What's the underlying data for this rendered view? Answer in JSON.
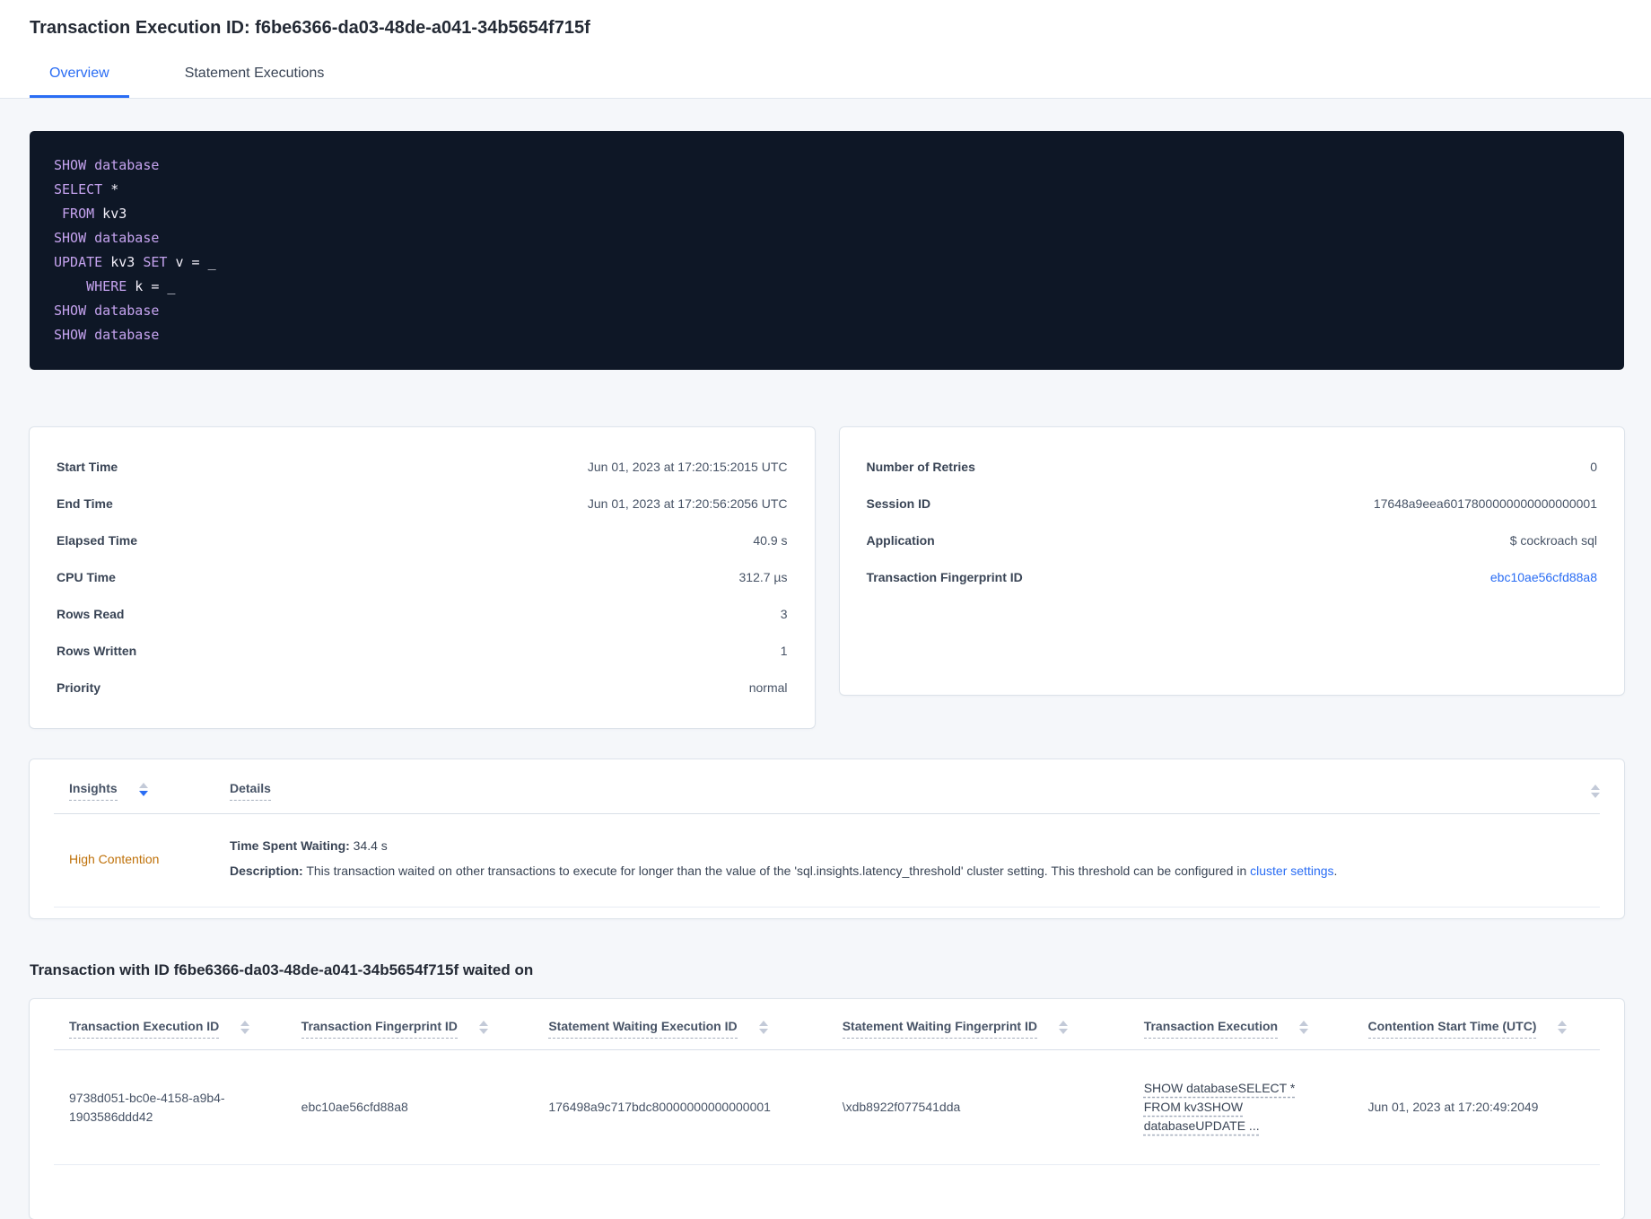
{
  "header": {
    "title": "Transaction Execution ID: f6be6366-da03-48de-a041-34b5654f715f"
  },
  "tabs": [
    {
      "label": "Overview",
      "active": true
    },
    {
      "label": "Statement Executions",
      "active": false
    }
  ],
  "sql": {
    "lines": [
      [
        {
          "t": "SHOW database",
          "c": "kw"
        }
      ],
      [
        {
          "t": "SELECT",
          "c": "kw"
        },
        {
          "t": " *",
          "c": "pl"
        }
      ],
      [
        {
          "t": " ",
          "c": "pl"
        },
        {
          "t": "FROM",
          "c": "kw"
        },
        {
          "t": " kv3",
          "c": "pl"
        }
      ],
      [
        {
          "t": "SHOW database",
          "c": "kw"
        }
      ],
      [
        {
          "t": "UPDATE",
          "c": "kw"
        },
        {
          "t": " kv3 ",
          "c": "pl"
        },
        {
          "t": "SET",
          "c": "kw"
        },
        {
          "t": " v = _",
          "c": "pl"
        }
      ],
      [
        {
          "t": "    ",
          "c": "pl"
        },
        {
          "t": "WHERE",
          "c": "kw"
        },
        {
          "t": " k = _",
          "c": "pl"
        }
      ],
      [
        {
          "t": "SHOW database",
          "c": "kw"
        }
      ],
      [
        {
          "t": "SHOW database",
          "c": "kw"
        }
      ]
    ]
  },
  "stats_card": {
    "rows": [
      {
        "label": "Start Time",
        "value": "Jun 01, 2023 at 17:20:15:2015 UTC"
      },
      {
        "label": "End Time",
        "value": "Jun 01, 2023 at 17:20:56:2056 UTC"
      },
      {
        "label": "Elapsed Time",
        "value": "40.9 s"
      },
      {
        "label": "CPU Time",
        "value": "312.7 µs"
      },
      {
        "label": "Rows Read",
        "value": "3"
      },
      {
        "label": "Rows Written",
        "value": "1"
      },
      {
        "label": "Priority",
        "value": "normal"
      }
    ]
  },
  "session_card": {
    "rows": [
      {
        "label": "Number of Retries",
        "value": "0"
      },
      {
        "label": "Session ID",
        "value": "17648a9eea6017800000000000000001"
      },
      {
        "label": "Application",
        "value": "$ cockroach sql"
      },
      {
        "label": "Transaction Fingerprint ID",
        "value": "ebc10ae56cfd88a8",
        "link": true
      }
    ]
  },
  "insights": {
    "columns": [
      {
        "label": "Insights",
        "sorted": "desc"
      },
      {
        "label": "Details",
        "sorted": null
      }
    ],
    "row": {
      "insight": "High Contention",
      "waiting_label": "Time Spent Waiting:",
      "waiting_value": " 34.4 s",
      "description_label": "Description:",
      "description_text": " This transaction waited on other transactions to execute for longer than the value of the 'sql.insights.latency_threshold' cluster setting. This threshold can be configured in ",
      "description_link": "cluster settings",
      "description_suffix": "."
    }
  },
  "waited_on": {
    "title": "Transaction with ID f6be6366-da03-48de-a041-34b5654f715f waited on",
    "columns": [
      "Transaction Execution ID",
      "Transaction Fingerprint ID",
      "Statement Waiting Execution ID",
      "Statement Waiting Fingerprint ID",
      "Transaction Execution",
      "Contention Start Time (UTC)"
    ],
    "column_widths": [
      "16%",
      "16%",
      "19%",
      "19.5%",
      "14.5%",
      "15%"
    ],
    "row": {
      "transaction_execution_id": "9738d051-bc0e-4158-a9b4-1903586ddd42",
      "transaction_fingerprint_id": "ebc10ae56cfd88a8",
      "statement_waiting_execution_id": "176498a9c717bdc80000000000000001",
      "statement_waiting_fingerprint_id": "\\xdb8922f077541dda",
      "transaction_execution": "SHOW databaseSELECT * FROM kv3SHOW databaseUPDATE ...",
      "contention_start_time": "Jun 01, 2023 at 17:20:49:2049"
    }
  },
  "colors": {
    "accent_blue": "#2a6df4",
    "high_contention_orange": "#bf7109",
    "code_background": "#0e1726",
    "code_keyword_purple": "#c5a3ef"
  }
}
